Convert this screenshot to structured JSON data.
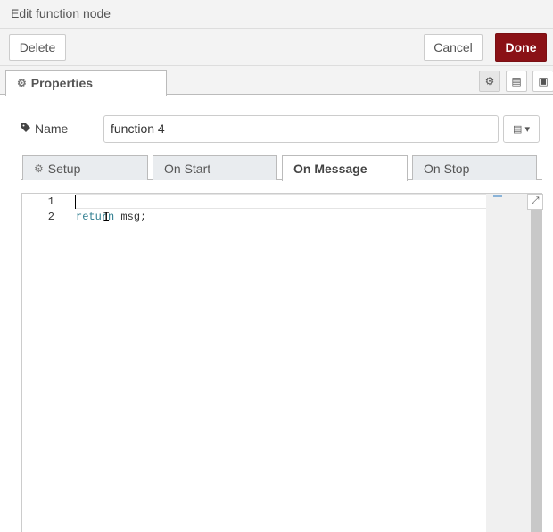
{
  "titlebar": {
    "title": "Edit function node"
  },
  "toolbar": {
    "delete_label": "Delete",
    "cancel_label": "Cancel",
    "done_label": "Done"
  },
  "tabs": {
    "properties_label": "Properties",
    "settings_icon": "⚙",
    "description_icon": "▤",
    "appearance_icon": "▣"
  },
  "name_field": {
    "label": "Name",
    "value": "function 4",
    "icon_button": "▤ ▾"
  },
  "subtabs": [
    {
      "label": "Setup",
      "icon": "⚙"
    },
    {
      "label": "On Start"
    },
    {
      "label": "On Message",
      "active": true
    },
    {
      "label": "On Stop"
    }
  ],
  "editor": {
    "lines": [
      {
        "number": "1",
        "text": ""
      },
      {
        "number": "2",
        "keyword": "return",
        "rest": " msg;"
      }
    ],
    "expand_icon": "⤢"
  },
  "colors": {
    "done_button": "#8a1116",
    "keyword": "#2e7d8f"
  }
}
